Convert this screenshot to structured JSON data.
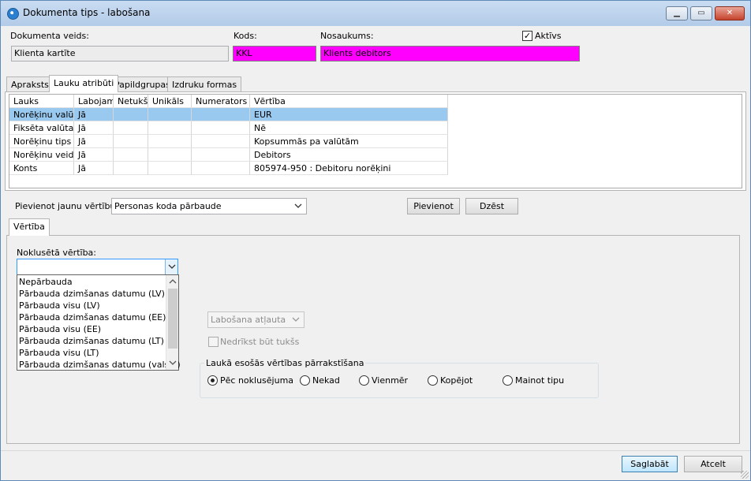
{
  "window": {
    "title": "Dokumenta tips - labošana"
  },
  "header": {
    "doc_type_label": "Dokumenta veids:",
    "doc_type_value": "Klienta kartīte",
    "code_label": "Kods:",
    "code_value": "KKL",
    "name_label": "Nosaukums:",
    "name_value": "Klients debitors",
    "active_label": "Aktīvs",
    "active_checked": true
  },
  "tabs": [
    "Apraksts",
    "Lauku atribūti",
    "Papildgrupas",
    "Izdruku formas"
  ],
  "active_tab": 1,
  "grid": {
    "columns": [
      "Lauks",
      "Labojams",
      "Netukšs",
      "Unikāls",
      "Numerators",
      "Vērtība"
    ],
    "rows": [
      [
        "Norēķinu valūta",
        "Jā",
        "",
        "",
        "",
        "EUR"
      ],
      [
        "Fiksēta valūta",
        "Jā",
        "",
        "",
        "",
        "Nē"
      ],
      [
        "Norēķinu tips",
        "Jā",
        "",
        "",
        "",
        "Kopsummās pa valūtām"
      ],
      [
        "Norēķinu veids",
        "Jā",
        "",
        "",
        "",
        "Debitors"
      ],
      [
        "Konts",
        "Jā",
        "",
        "",
        "",
        "805974-950 : Debitoru norēķini"
      ]
    ],
    "selected_row": 0
  },
  "add_value": {
    "label": "Pievienot jaunu vērtību:",
    "selected": "Personas koda pārbaude",
    "add_button": "Pievienot",
    "delete_button": "Dzēst"
  },
  "subtab": {
    "label": "Vērtība"
  },
  "default_value": {
    "label": "Noklusētā vērtība:",
    "value": "",
    "options": [
      "Nepārbauda",
      "Pārbauda dzimšanas datumu (LV)",
      "Pārbauda visu (LV)",
      "Pārbauda dzimšanas datumu (EE)",
      "Pārbauda visu (EE)",
      "Pārbauda dzimšanas datumu (LT)",
      "Pārbauda visu (LT)",
      "Pārbauda dzimšanas datumu (valsts)"
    ]
  },
  "edit_mode": {
    "value": "Labošana atļauta"
  },
  "not_empty": {
    "label": "Nedrīkst būt tukšs",
    "checked": false
  },
  "overwrite": {
    "title": "Laukā esošās vērtības pārrakstīšana",
    "options": [
      "Pēc noklusējuma",
      "Nekad",
      "Vienmēr",
      "Kopējot",
      "Mainot tipu"
    ],
    "selected": 0
  },
  "footer": {
    "save": "Saglabāt",
    "cancel": "Atcelt"
  }
}
